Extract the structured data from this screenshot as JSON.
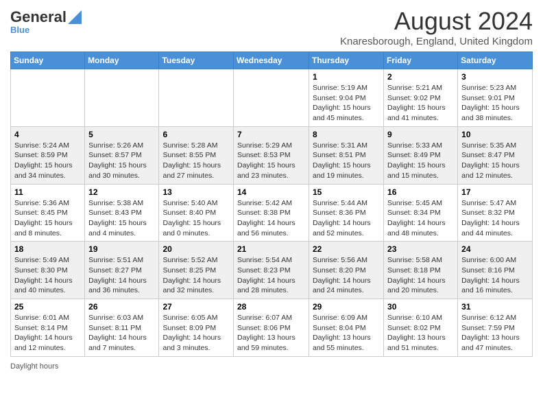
{
  "header": {
    "logo_general": "General",
    "logo_blue": "Blue",
    "title": "August 2024",
    "subtitle": "Knaresborough, England, United Kingdom"
  },
  "columns": [
    "Sunday",
    "Monday",
    "Tuesday",
    "Wednesday",
    "Thursday",
    "Friday",
    "Saturday"
  ],
  "weeks": [
    [
      {
        "day": "",
        "info": ""
      },
      {
        "day": "",
        "info": ""
      },
      {
        "day": "",
        "info": ""
      },
      {
        "day": "",
        "info": ""
      },
      {
        "day": "1",
        "info": "Sunrise: 5:19 AM\nSunset: 9:04 PM\nDaylight: 15 hours and 45 minutes."
      },
      {
        "day": "2",
        "info": "Sunrise: 5:21 AM\nSunset: 9:02 PM\nDaylight: 15 hours and 41 minutes."
      },
      {
        "day": "3",
        "info": "Sunrise: 5:23 AM\nSunset: 9:01 PM\nDaylight: 15 hours and 38 minutes."
      }
    ],
    [
      {
        "day": "4",
        "info": "Sunrise: 5:24 AM\nSunset: 8:59 PM\nDaylight: 15 hours and 34 minutes."
      },
      {
        "day": "5",
        "info": "Sunrise: 5:26 AM\nSunset: 8:57 PM\nDaylight: 15 hours and 30 minutes."
      },
      {
        "day": "6",
        "info": "Sunrise: 5:28 AM\nSunset: 8:55 PM\nDaylight: 15 hours and 27 minutes."
      },
      {
        "day": "7",
        "info": "Sunrise: 5:29 AM\nSunset: 8:53 PM\nDaylight: 15 hours and 23 minutes."
      },
      {
        "day": "8",
        "info": "Sunrise: 5:31 AM\nSunset: 8:51 PM\nDaylight: 15 hours and 19 minutes."
      },
      {
        "day": "9",
        "info": "Sunrise: 5:33 AM\nSunset: 8:49 PM\nDaylight: 15 hours and 15 minutes."
      },
      {
        "day": "10",
        "info": "Sunrise: 5:35 AM\nSunset: 8:47 PM\nDaylight: 15 hours and 12 minutes."
      }
    ],
    [
      {
        "day": "11",
        "info": "Sunrise: 5:36 AM\nSunset: 8:45 PM\nDaylight: 15 hours and 8 minutes."
      },
      {
        "day": "12",
        "info": "Sunrise: 5:38 AM\nSunset: 8:43 PM\nDaylight: 15 hours and 4 minutes."
      },
      {
        "day": "13",
        "info": "Sunrise: 5:40 AM\nSunset: 8:40 PM\nDaylight: 15 hours and 0 minutes."
      },
      {
        "day": "14",
        "info": "Sunrise: 5:42 AM\nSunset: 8:38 PM\nDaylight: 14 hours and 56 minutes."
      },
      {
        "day": "15",
        "info": "Sunrise: 5:44 AM\nSunset: 8:36 PM\nDaylight: 14 hours and 52 minutes."
      },
      {
        "day": "16",
        "info": "Sunrise: 5:45 AM\nSunset: 8:34 PM\nDaylight: 14 hours and 48 minutes."
      },
      {
        "day": "17",
        "info": "Sunrise: 5:47 AM\nSunset: 8:32 PM\nDaylight: 14 hours and 44 minutes."
      }
    ],
    [
      {
        "day": "18",
        "info": "Sunrise: 5:49 AM\nSunset: 8:30 PM\nDaylight: 14 hours and 40 minutes."
      },
      {
        "day": "19",
        "info": "Sunrise: 5:51 AM\nSunset: 8:27 PM\nDaylight: 14 hours and 36 minutes."
      },
      {
        "day": "20",
        "info": "Sunrise: 5:52 AM\nSunset: 8:25 PM\nDaylight: 14 hours and 32 minutes."
      },
      {
        "day": "21",
        "info": "Sunrise: 5:54 AM\nSunset: 8:23 PM\nDaylight: 14 hours and 28 minutes."
      },
      {
        "day": "22",
        "info": "Sunrise: 5:56 AM\nSunset: 8:20 PM\nDaylight: 14 hours and 24 minutes."
      },
      {
        "day": "23",
        "info": "Sunrise: 5:58 AM\nSunset: 8:18 PM\nDaylight: 14 hours and 20 minutes."
      },
      {
        "day": "24",
        "info": "Sunrise: 6:00 AM\nSunset: 8:16 PM\nDaylight: 14 hours and 16 minutes."
      }
    ],
    [
      {
        "day": "25",
        "info": "Sunrise: 6:01 AM\nSunset: 8:14 PM\nDaylight: 14 hours and 12 minutes."
      },
      {
        "day": "26",
        "info": "Sunrise: 6:03 AM\nSunset: 8:11 PM\nDaylight: 14 hours and 7 minutes."
      },
      {
        "day": "27",
        "info": "Sunrise: 6:05 AM\nSunset: 8:09 PM\nDaylight: 14 hours and 3 minutes."
      },
      {
        "day": "28",
        "info": "Sunrise: 6:07 AM\nSunset: 8:06 PM\nDaylight: 13 hours and 59 minutes."
      },
      {
        "day": "29",
        "info": "Sunrise: 6:09 AM\nSunset: 8:04 PM\nDaylight: 13 hours and 55 minutes."
      },
      {
        "day": "30",
        "info": "Sunrise: 6:10 AM\nSunset: 8:02 PM\nDaylight: 13 hours and 51 minutes."
      },
      {
        "day": "31",
        "info": "Sunrise: 6:12 AM\nSunset: 7:59 PM\nDaylight: 13 hours and 47 minutes."
      }
    ]
  ],
  "footer": {
    "daylight_hours": "Daylight hours"
  }
}
